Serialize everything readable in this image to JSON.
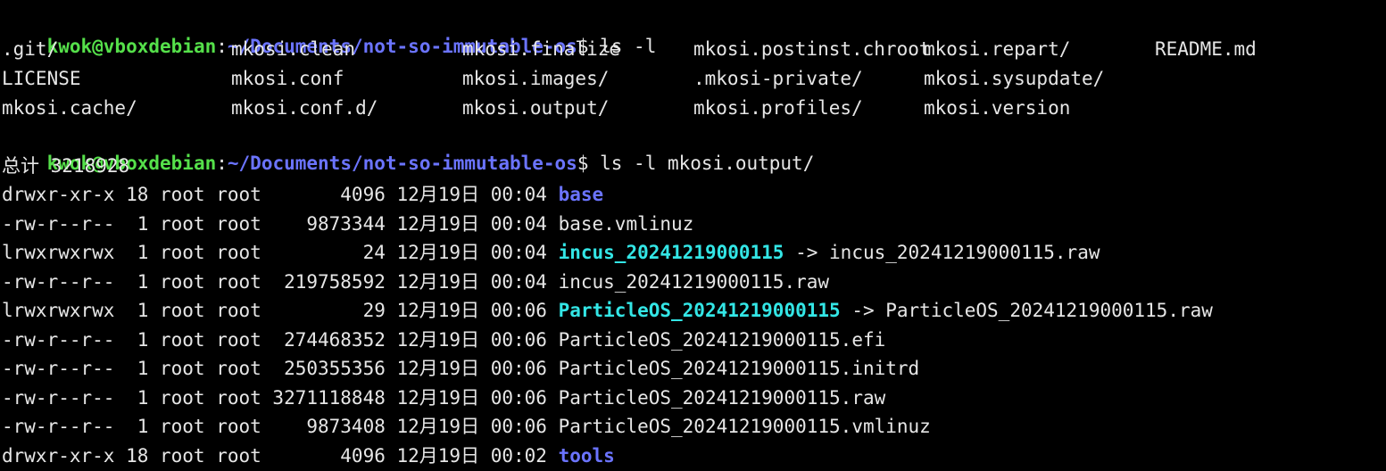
{
  "terminal": {
    "colors": {
      "background": "#000000",
      "foreground": "#e6e6e6",
      "user": "#55e04a",
      "path": "#6b74ff",
      "directory": "#6b74ff",
      "symlink": "#33e6e6"
    },
    "top_partial_line": "                                                                                                                        ",
    "prompt1": {
      "user_host": "kwok@vboxdebian",
      "separator": ":",
      "path": "~/Documents/not-so-immutable-os",
      "symbol": "$",
      "command": " ls -l"
    },
    "ls_grid": [
      [
        ".git/",
        "mkosi.clean",
        "mkosi.finalize",
        "mkosi.postinst.chroot",
        "mkosi.repart/",
        "README.md"
      ],
      [
        "LICENSE",
        "mkosi.conf",
        "mkosi.images/",
        ".mkosi-private/",
        "mkosi.sysupdate/",
        ""
      ],
      [
        "mkosi.cache/",
        "mkosi.conf.d/",
        "mkosi.output/",
        "mkosi.profiles/",
        "mkosi.version",
        ""
      ]
    ],
    "prompt2": {
      "user_host": "kwok@vboxdebian",
      "separator": ":",
      "path": "~/Documents/not-so-immutable-os",
      "symbol": "$",
      "command": " ls -l mkosi.output/"
    },
    "total_line": "总计 3218928",
    "listing": [
      {
        "meta": "drwxr-xr-x 18 root root       4096 12月19日 00:04 ",
        "name": "base",
        "kind": "dir",
        "target": ""
      },
      {
        "meta": "-rw-r--r--  1 root root    9873344 12月19日 00:04 ",
        "name": "base.vmlinuz",
        "kind": "file",
        "target": ""
      },
      {
        "meta": "lrwxrwxrwx  1 root root         24 12月19日 00:04 ",
        "name": "incus_20241219000115",
        "kind": "link",
        "target": " -> incus_20241219000115.raw"
      },
      {
        "meta": "-rw-r--r--  1 root root  219758592 12月19日 00:04 ",
        "name": "incus_20241219000115.raw",
        "kind": "file",
        "target": ""
      },
      {
        "meta": "lrwxrwxrwx  1 root root         29 12月19日 00:06 ",
        "name": "ParticleOS_20241219000115",
        "kind": "link",
        "target": " -> ParticleOS_20241219000115.raw"
      },
      {
        "meta": "-rw-r--r--  1 root root  274468352 12月19日 00:06 ",
        "name": "ParticleOS_20241219000115.efi",
        "kind": "file",
        "target": ""
      },
      {
        "meta": "-rw-r--r--  1 root root  250355356 12月19日 00:06 ",
        "name": "ParticleOS_20241219000115.initrd",
        "kind": "file",
        "target": ""
      },
      {
        "meta": "-rw-r--r--  1 root root 3271118848 12月19日 00:06 ",
        "name": "ParticleOS_20241219000115.raw",
        "kind": "file",
        "target": ""
      },
      {
        "meta": "-rw-r--r--  1 root root    9873408 12月19日 00:06 ",
        "name": "ParticleOS_20241219000115.vmlinuz",
        "kind": "file",
        "target": ""
      },
      {
        "meta": "drwxr-xr-x 18 root root       4096 12月19日 00:02 ",
        "name": "tools",
        "kind": "dir",
        "target": ""
      }
    ]
  }
}
